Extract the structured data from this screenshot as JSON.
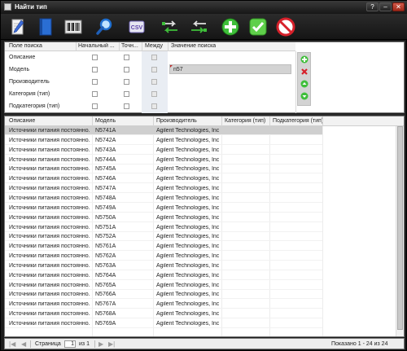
{
  "window": {
    "title": "Найти тип",
    "buttons": [
      "?",
      "–",
      "✕"
    ]
  },
  "toolbar": [
    {
      "name": "edit-document-button",
      "icon": "edit-document-icon"
    },
    {
      "name": "book-button",
      "icon": "book-icon"
    },
    {
      "name": "barcode-button",
      "icon": "barcode-icon"
    },
    {
      "name": "search-button",
      "icon": "search-icon"
    },
    {
      "name": "csv-export-button",
      "icon": "csv-icon",
      "label": "CSV"
    },
    {
      "name": "transfer-right-button",
      "icon": "transfer-right-icon"
    },
    {
      "name": "transfer-left-button",
      "icon": "transfer-left-icon"
    },
    {
      "name": "add-button",
      "icon": "plus-icon"
    },
    {
      "name": "confirm-button",
      "icon": "check-icon"
    },
    {
      "name": "cancel-button",
      "icon": "no-entry-icon"
    }
  ],
  "search": {
    "headers": {
      "field": "Поле поиска",
      "starts": "Начальный ...",
      "exact": "Точн...",
      "between": "Между",
      "value": "Значение поиска"
    },
    "rows": [
      {
        "field": "Описание",
        "value": ""
      },
      {
        "field": "Модель",
        "value": "n57"
      },
      {
        "field": "Производитель",
        "value": ""
      },
      {
        "field": "Категория (тип)",
        "value": ""
      },
      {
        "field": "Подкатегория (тип)",
        "value": ""
      }
    ],
    "side_buttons": [
      "add-row-icon",
      "delete-row-icon",
      "move-up-icon",
      "move-down-icon"
    ]
  },
  "grid": {
    "headers": {
      "description": "Описание",
      "model": "Модель",
      "manufacturer": "Производитель",
      "category": "Категория (тип)",
      "subcategory": "Подкатегория (тип)"
    },
    "rows": [
      {
        "description": "Источники питания постоянно...",
        "model": "N5741A",
        "manufacturer": "Agilent Technologies, Inc"
      },
      {
        "description": "Источники питания постоянно...",
        "model": "N5742A",
        "manufacturer": "Agilent Technologies, Inc"
      },
      {
        "description": "Источники питания постоянно...",
        "model": "N5743A",
        "manufacturer": "Agilent Technologies, Inc"
      },
      {
        "description": "Источники питания постоянно...",
        "model": "N5744A",
        "manufacturer": "Agilent Technologies, Inc"
      },
      {
        "description": "Источники питания постоянно...",
        "model": "N5745A",
        "manufacturer": "Agilent Technologies, Inc"
      },
      {
        "description": "Источники питания постоянно...",
        "model": "N5746A",
        "manufacturer": "Agilent Technologies, Inc"
      },
      {
        "description": "Источники питания постоянно...",
        "model": "N5747A",
        "manufacturer": "Agilent Technologies, Inc"
      },
      {
        "description": "Источники питания постоянно...",
        "model": "N5748A",
        "manufacturer": "Agilent Technologies, Inc"
      },
      {
        "description": "Источники питания постоянно...",
        "model": "N5749A",
        "manufacturer": "Agilent Technologies, Inc"
      },
      {
        "description": "Источники питания постоянно...",
        "model": "N5750A",
        "manufacturer": "Agilent Technologies, Inc"
      },
      {
        "description": "Источники питания постоянно...",
        "model": "N5751A",
        "manufacturer": "Agilent Technologies, Inc"
      },
      {
        "description": "Источники питания постоянно...",
        "model": "N5752A",
        "manufacturer": "Agilent Technologies, Inc"
      },
      {
        "description": "Источники питания постоянно...",
        "model": "N5761A",
        "manufacturer": "Agilent Technologies, Inc"
      },
      {
        "description": "Источники питания постоянно...",
        "model": "N5762A",
        "manufacturer": "Agilent Technologies, Inc"
      },
      {
        "description": "Источники питания постоянно...",
        "model": "N5763A",
        "manufacturer": "Agilent Technologies, Inc"
      },
      {
        "description": "Источники питания постоянно...",
        "model": "N5764A",
        "manufacturer": "Agilent Technologies, Inc"
      },
      {
        "description": "Источники питания постоянно...",
        "model": "N5765A",
        "manufacturer": "Agilent Technologies, Inc"
      },
      {
        "description": "Источники питания постоянно...",
        "model": "N5766A",
        "manufacturer": "Agilent Technologies, Inc"
      },
      {
        "description": "Источники питания постоянно...",
        "model": "N5767A",
        "manufacturer": "Agilent Technologies, Inc"
      },
      {
        "description": "Источники питания постоянно...",
        "model": "N5768A",
        "manufacturer": "Agilent Technologies, Inc"
      },
      {
        "description": "Источники питания постоянно...",
        "model": "N5769A",
        "manufacturer": "Agilent Technologies, Inc"
      }
    ],
    "selected_row": 0
  },
  "pager": {
    "page_label": "Страница",
    "page_value": "1",
    "of_label": "из 1",
    "status": "Показано 1 - 24 из 24"
  },
  "colors": {
    "window_bg": "#1c1c1c",
    "selection": "#cfcfcf",
    "accent_green": "#3fbf3a",
    "accent_red": "#d6202a"
  }
}
